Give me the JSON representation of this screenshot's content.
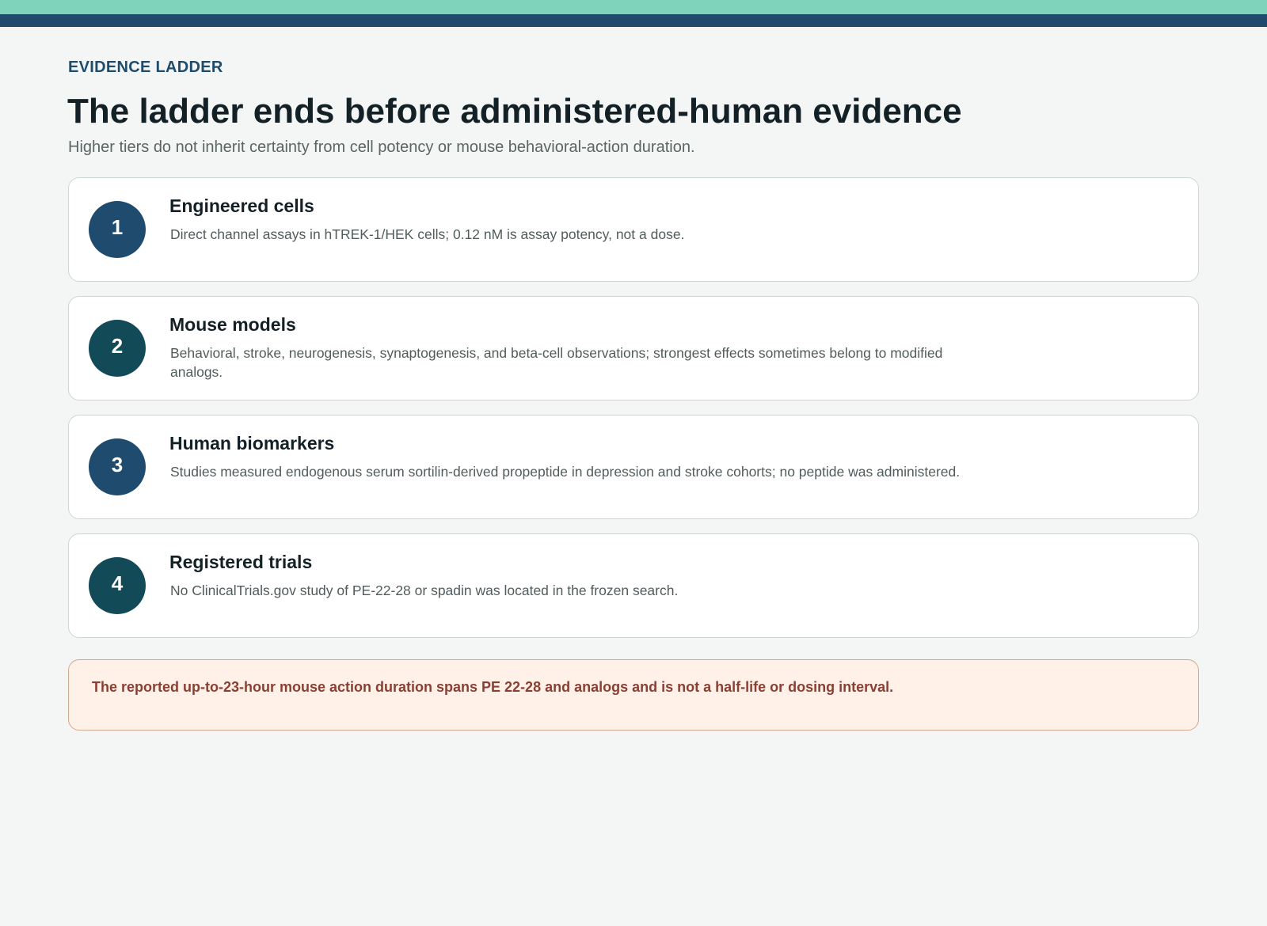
{
  "header": {
    "kicker": "EVIDENCE LADDER",
    "title": "The ladder ends before administered-human evidence",
    "subtitle": "Higher tiers do not inherit certainty from cell potency or mouse behavioral-action duration."
  },
  "tiers": [
    {
      "number": "1",
      "title": "Engineered cells",
      "description": "Direct channel assays in hTREK-1/HEK cells; 0.12 nM is assay potency, not a dose.",
      "badge_color": "#1f4b6e"
    },
    {
      "number": "2",
      "title": "Mouse models",
      "description": "Behavioral, stroke, neurogenesis, synaptogenesis, and beta-cell observations; strongest effects sometimes belong to modified analogs.",
      "badge_color": "#134a58"
    },
    {
      "number": "3",
      "title": "Human biomarkers",
      "description": "Studies measured endogenous serum sortilin-derived propeptide in depression and stroke cohorts; no peptide was administered.",
      "badge_color": "#1f4b6e"
    },
    {
      "number": "4",
      "title": "Registered trials",
      "description": "No ClinicalTrials.gov study of PE-22-28 or spadin was located in the frozen search.",
      "badge_color": "#134a58"
    }
  ],
  "callout": {
    "text": "The reported up-to-23-hour mouse action duration spans PE 22-28 and analogs and is not a half-life or dosing interval."
  },
  "colors": {
    "accent_band": "#7fd3bb",
    "rule": "#204a6b",
    "callout_background": "#fff0e8",
    "callout_text": "#8a3f33"
  }
}
